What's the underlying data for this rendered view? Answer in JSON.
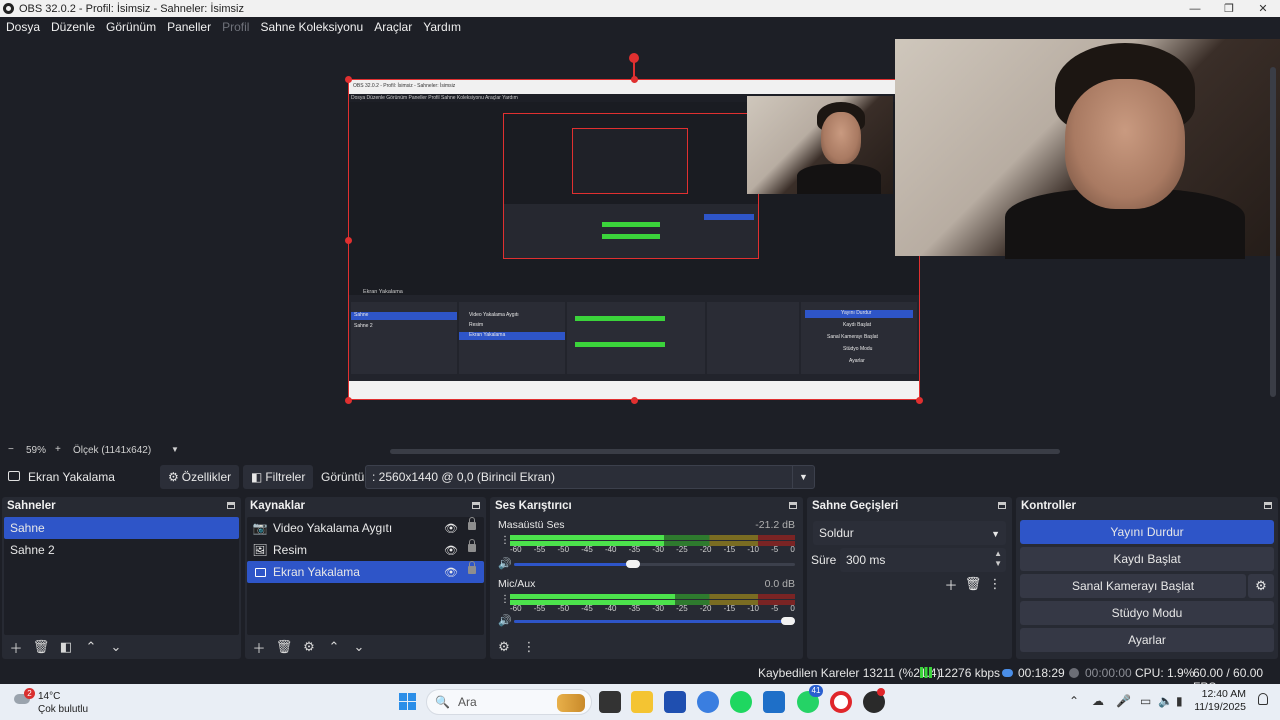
{
  "window": {
    "title": "OBS 32.0.2 - Profil: İsimsiz - Sahneler: İsimsiz",
    "minimize": "—",
    "maximize": "❐",
    "close": "✕"
  },
  "menu": {
    "items": [
      "Dosya",
      "Düzenle",
      "Görünüm",
      "Paneller",
      "Profil",
      "Sahne Koleksiyonu",
      "Araçlar",
      "Yardım"
    ]
  },
  "zoom": {
    "minus": "−",
    "level": "59%",
    "plus": "+",
    "scale_label": "Ölçek (1141x642)"
  },
  "source_toolbar": {
    "source_name": "Ekran Yakalama",
    "properties_label": "Özellikler",
    "filters_label": "Filtreler",
    "display_label": "Görüntü",
    "display_value": ": 2560x1440 @ 0,0 (Birincil Ekran)"
  },
  "scenes": {
    "title": "Sahneler",
    "items": [
      "Sahne",
      "Sahne 2"
    ],
    "selected_index": 0
  },
  "sources": {
    "title": "Kaynaklar",
    "items": [
      {
        "label": "Video Yakalama Aygıtı",
        "icon": "camera-icon"
      },
      {
        "label": "Resim",
        "icon": "image-icon"
      },
      {
        "label": "Ekran Yakalama",
        "icon": "monitor-icon"
      }
    ],
    "selected_index": 2
  },
  "mixer": {
    "title": "Ses Karıştırıcı",
    "channels": [
      {
        "name": "Masaüstü Ses",
        "db": "-21.2 dB",
        "level": 0.54,
        "volume": 0.45
      },
      {
        "name": "Mic/Aux",
        "db": "0.0 dB",
        "level": 0.58,
        "volume": 1.0
      }
    ],
    "scale": [
      "-60",
      "-55",
      "-50",
      "-45",
      "-40",
      "-35",
      "-30",
      "-25",
      "-20",
      "-15",
      "-10",
      "-5",
      "0"
    ]
  },
  "transitions": {
    "title": "Sahne Geçişleri",
    "selected": "Soldur",
    "duration_label": "Süre",
    "duration_value": "300 ms"
  },
  "controls": {
    "title": "Kontroller",
    "stop_stream": "Yayını Durdur",
    "start_recording": "Kaydı Başlat",
    "virtual_camera": "Sanal Kamerayı Başlat",
    "studio_mode": "Stüdyo Modu",
    "settings": "Ayarlar"
  },
  "status": {
    "dropped_frames": "Kaybedilen Kareler 13211 (%21.4)",
    "bitrate": "12276 kbps",
    "stream_time": "00:18:29",
    "record_time": "00:00:00",
    "cpu": "CPU: 1.9%",
    "fps": "60.00 / 60.00 FPS"
  },
  "taskbar": {
    "weather_temp": "14°C",
    "weather_desc": "Çok bulutlu",
    "weather_badge": "2",
    "search_placeholder": "Ara",
    "whatsapp_badge": "41",
    "time": "12:40 AM",
    "date": "11/19/2025"
  },
  "mini_preview": {
    "title": "OBS 32.0.2 - Profil: İsimsiz - Sahneler: İsimsiz",
    "menu": "Dosya  Düzenle  Görünüm  Paneller  Profil  Sahne Koleksiyonu  Araçlar  Yardım",
    "source": "Ekran Yakalama",
    "scenes": [
      "Sahne",
      "Sahne 2"
    ],
    "sources": [
      "Video Yakalama Aygıtı",
      "Resim",
      "Ekran Yakalama"
    ],
    "controls": [
      "Yayını Durdur",
      "Kaydı Başlat",
      "Sanal Kamerayı Başlat",
      "Stüdyo Modu",
      "Ayarlar"
    ]
  },
  "colors": {
    "accent": "#2e55c8",
    "background": "#1d1f26",
    "dock": "#272a33",
    "selection_border": "#e03030"
  }
}
